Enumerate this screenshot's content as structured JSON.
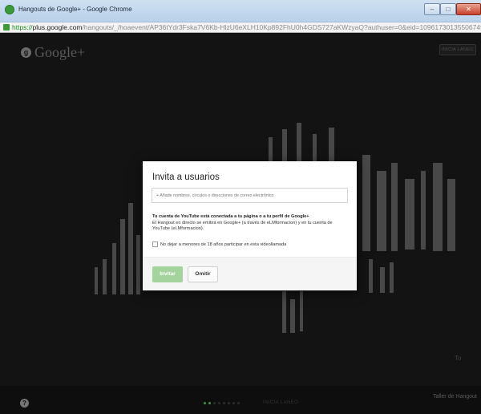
{
  "window": {
    "title": "Hangouts de Google+ - Google Chrome",
    "minimize": "–",
    "maximize": "□",
    "close": "✕"
  },
  "address_bar": {
    "scheme": "https://",
    "host": "plus.google.com",
    "path": "/hangouts/_/hoaevent/AP36tYdr3Fska7V6Kb-HlzU6eXLH10Kp892FhU0h4GDS727aKWzyaQ?authuser=0&eid=10961730135506749465"
  },
  "app": {
    "logo_badge": "g",
    "logo_text": "Google+",
    "top_right_button": "INICIA LANEO",
    "help_icon": "?",
    "bottom_label": "INICIA LANEO",
    "workshop_label": "Taller de Hangout",
    "overlay_text": "To"
  },
  "dialog": {
    "title": "Invita a usuarios",
    "input_placeholder": "+ Añade nombres, círculos o direcciones de correo electrónico",
    "youtube_heading": "Tu cuenta de YouTube está conectada a tu página o a tu perfil de Google+",
    "youtube_text": "El Hangout en directo se emitirá en Google+ (a través de eLMformacion) y en tu cuenta de YouTube (eLMformacion).",
    "minors_checkbox_label": "No dejar a menores de 18 años participar en esta videollamada",
    "minors_checked": false,
    "invite_button": "Invitar",
    "skip_button": "Omitir"
  },
  "colors": {
    "invite_button": "#a5d39e",
    "secure_scheme": "#1b8a1b",
    "background": "#171717"
  }
}
